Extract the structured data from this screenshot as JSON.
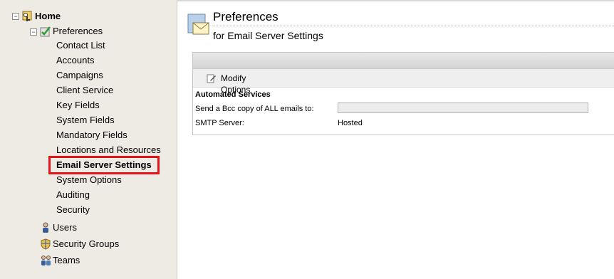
{
  "sidebar": {
    "home": "Home",
    "preferences": "Preferences",
    "children": [
      "Contact List",
      "Accounts",
      "Campaigns",
      "Client Service",
      "Key Fields",
      "System Fields",
      "Mandatory Fields",
      "Locations and Resources",
      "Email Server Settings",
      "System Options",
      "Auditing",
      "Security"
    ],
    "selected": "Email Server Settings",
    "users": "Users",
    "security_groups": "Security Groups",
    "teams": "Teams"
  },
  "header": {
    "title": "Preferences",
    "subtitle": "for Email Server Settings"
  },
  "toolbar": {
    "modify_label": "Modify Options"
  },
  "section": {
    "heading": "Automated Services",
    "bcc_label": "Send a Bcc copy of ALL emails to:",
    "bcc_value": "",
    "smtp_label": "SMTP Server:",
    "smtp_value": "Hosted"
  },
  "colors": {
    "highlight": "#e3141a",
    "sidebar_bg": "#eeebe4"
  },
  "icons": [
    "collapse-icon",
    "home-keys-icon",
    "preferences-check-icon",
    "users-icon",
    "security-groups-icon",
    "teams-icon",
    "envelope-icon",
    "edit-icon"
  ]
}
